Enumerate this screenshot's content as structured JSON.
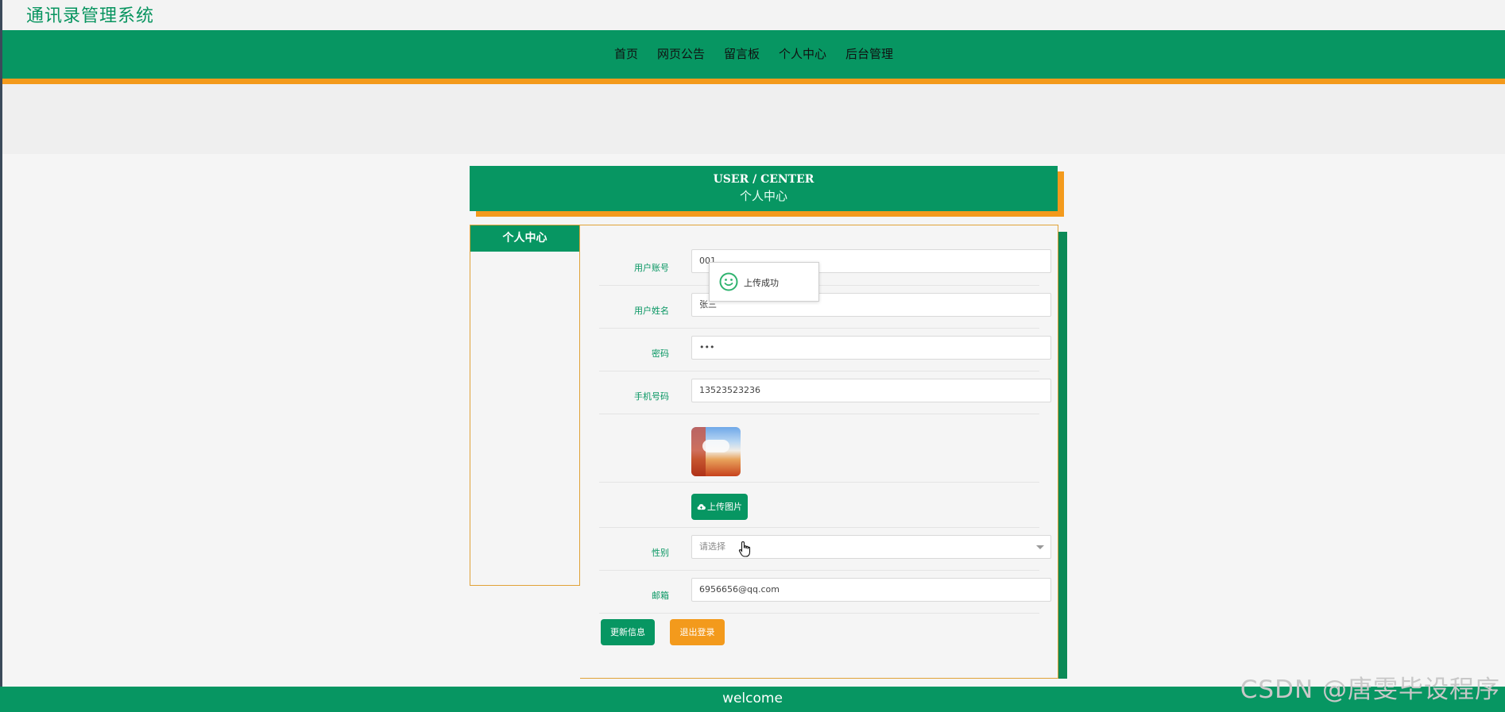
{
  "site": {
    "title": "通讯录管理系统"
  },
  "nav": {
    "items": [
      {
        "label": "首页"
      },
      {
        "label": "网页公告"
      },
      {
        "label": "留言板"
      },
      {
        "label": "个人中心"
      },
      {
        "label": "后台管理"
      }
    ]
  },
  "header": {
    "title_en": "USER / CENTER",
    "title_cn": "个人中心"
  },
  "sidebar": {
    "items": [
      {
        "label": "个人中心"
      }
    ]
  },
  "form": {
    "account": {
      "label": "用户账号",
      "value": "001"
    },
    "name": {
      "label": "用户姓名",
      "value": "张三"
    },
    "password": {
      "label": "密码",
      "value": "•••"
    },
    "phone": {
      "label": "手机号码",
      "value": "13523523236"
    },
    "upload_label": "上传图片",
    "gender": {
      "label": "性别",
      "placeholder": "请选择"
    },
    "email": {
      "label": "邮箱",
      "value": "6956656@qq.com"
    },
    "update_label": "更新信息",
    "logout_label": "退出登录"
  },
  "toast": {
    "text": "上传成功"
  },
  "footer": {
    "text": "welcome"
  },
  "watermark": {
    "text": "CSDN @唐雯毕设程序"
  },
  "colors": {
    "primary": "#079662",
    "accent": "#f39a1c",
    "background": "#f5f5f5"
  },
  "icons": {
    "toast": "smile-icon",
    "upload": "cloud-upload-icon",
    "cursor": "hand-pointer-icon"
  }
}
